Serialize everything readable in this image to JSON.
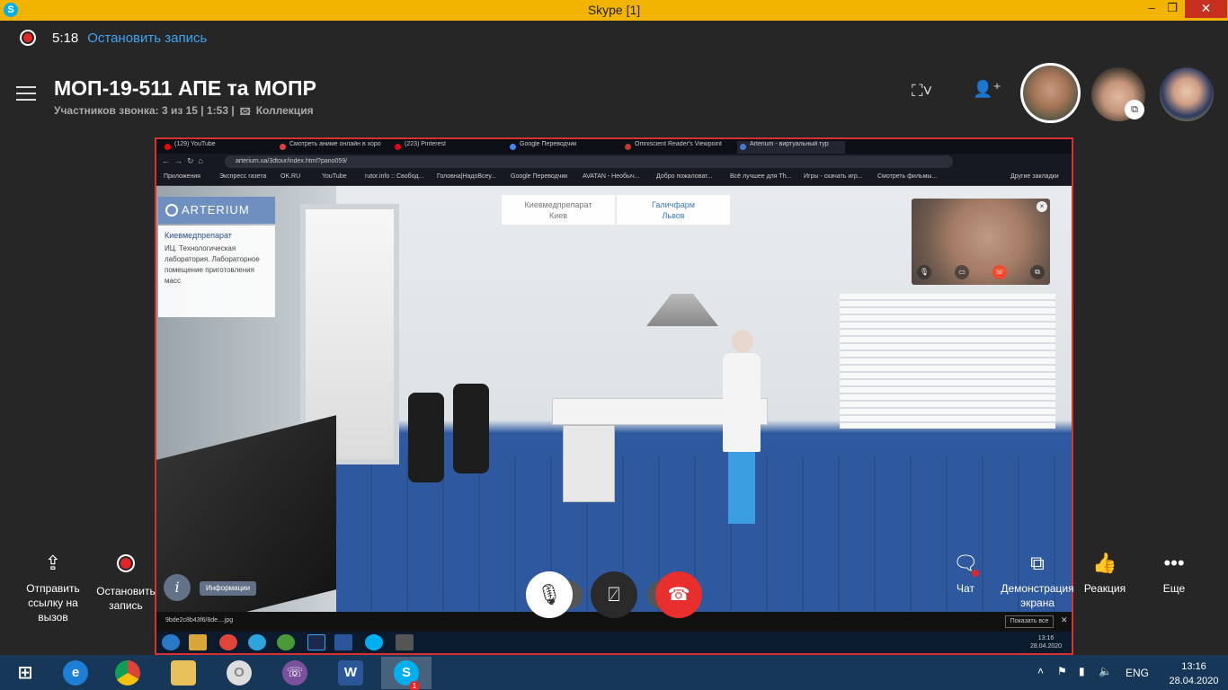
{
  "window": {
    "title": "Skype [1]",
    "icon": "S",
    "minimize": "–",
    "maximize": "❐",
    "close": "✕"
  },
  "recording": {
    "time": "5:18",
    "stop_label": "Остановить запись"
  },
  "call": {
    "title": "МОП-19-511 АПЕ та МОПР",
    "participants": "Участников звонка: 3 из 15 | 1:53 |",
    "collection": "Коллекция"
  },
  "browser": {
    "tabs": [
      {
        "label": "(129) YouTube",
        "color": "#ff0000"
      },
      {
        "label": "Смотреть аниме онлайн в хоро",
        "color": "#e04040"
      },
      {
        "label": "(223) Pinterest",
        "color": "#e60023"
      },
      {
        "label": "Google Переводчик",
        "color": "#4285f4"
      },
      {
        "label": "Omniscient Reader's Viewpoint",
        "color": "#c0392b"
      },
      {
        "label": "Arterium - виртуальный тур",
        "color": "#4a7bd0"
      }
    ],
    "url": "arterium.ua/3dtour/index.html?pano059/",
    "bookmarks": [
      "Приложения",
      "Экспресс газета",
      "OK.RU",
      "YouTube",
      "rutor.info :: Свобод...",
      "Головна|НадоВсеу...",
      "Google Переводчик",
      "AVATAN - Необыч...",
      "Добро пожаловат...",
      "Всё лучшее для Th...",
      "Игры - скачать игр...",
      "Смотреть фильмы..."
    ],
    "other_bookmarks": "Другие закладки"
  },
  "tour": {
    "logo": "ARTERIUM",
    "card_title": "Киевмедпрепарат",
    "card_text": "ИЦ. Технологическая лаборатория. Лабораторное помещение приготовления масс",
    "locations": [
      {
        "name": "Киевмедпрепарат",
        "city": "Киев"
      },
      {
        "name": "Галичфарм",
        "city": "Львов"
      }
    ],
    "info_icon": "i",
    "info_label": "Информации"
  },
  "downloads": {
    "file": "9bde2c8b43f6/8de....jpg",
    "show_all": "Показать все"
  },
  "inner_clock": {
    "time": "13:16",
    "date": "28.04.2020"
  },
  "controls": {
    "share_link": "Отправить ссылку на вызов",
    "stop_recording": "Остановить запись",
    "chat": "Чат",
    "screen_share": "Демонстрация экрана",
    "reaction": "Реакция",
    "more": "Еще"
  },
  "taskbar": {
    "skype_badge": "1",
    "language": "ENG",
    "time": "13:16",
    "date": "28.04.2020"
  }
}
